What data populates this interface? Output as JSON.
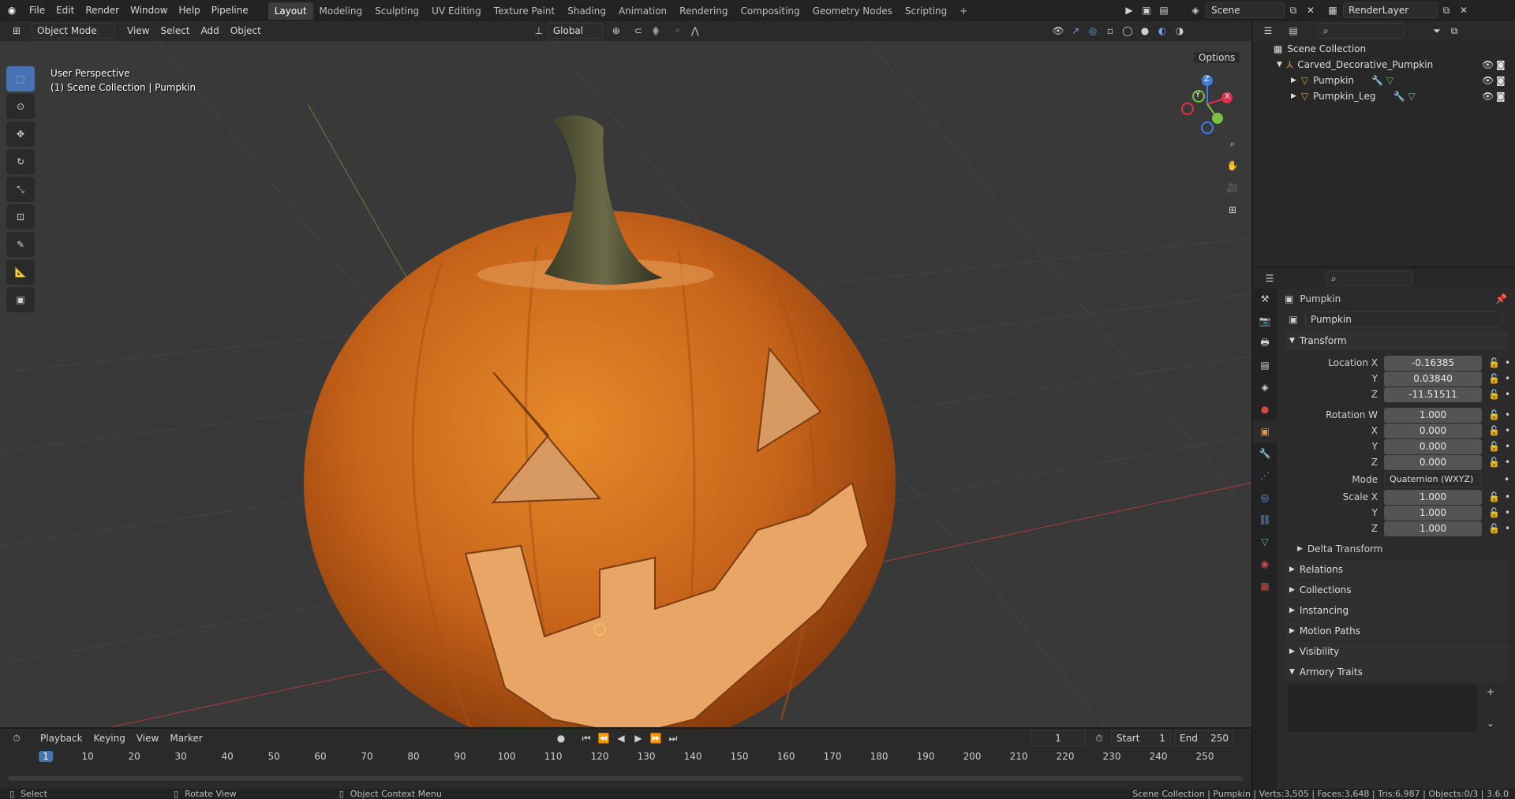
{
  "app": {
    "menu": [
      "File",
      "Edit",
      "Render",
      "Window",
      "Help",
      "Pipeline"
    ],
    "workspaces": [
      "Layout",
      "Modeling",
      "Sculpting",
      "UV Editing",
      "Texture Paint",
      "Shading",
      "Animation",
      "Rendering",
      "Compositing",
      "Geometry Nodes",
      "Scripting"
    ],
    "active_workspace": "Layout",
    "scene": "Scene",
    "view_layer": "RenderLayer"
  },
  "viewport_header": {
    "mode": "Object Mode",
    "menus": [
      "View",
      "Select",
      "Add",
      "Object"
    ],
    "orientation": "Global",
    "options": "Options"
  },
  "viewport": {
    "perspective": "User Perspective",
    "collection_info": "(1) Scene Collection | Pumpkin",
    "gizmo": {
      "x": "X",
      "y": "Y",
      "z": "Z"
    }
  },
  "outliner": {
    "root": "Scene Collection",
    "items": [
      {
        "name": "Carved_Decorative_Pumpkin"
      },
      {
        "name": "Pumpkin"
      },
      {
        "name": "Pumpkin_Leg"
      }
    ]
  },
  "properties": {
    "object_name": "Pumpkin",
    "object_field": "Pumpkin",
    "transform_title": "Transform",
    "location": {
      "label": "Location X",
      "x": "-0.16385",
      "y": "0.03840",
      "z": "-11.51511"
    },
    "rotation": {
      "label": "Rotation W",
      "w": "1.000",
      "x": "0.000",
      "y": "0.000",
      "z": "0.000"
    },
    "mode": {
      "label": "Mode",
      "value": "Quaternion (WXYZ)"
    },
    "scale": {
      "label": "Scale X",
      "x": "1.000",
      "y": "1.000",
      "z": "1.000"
    },
    "axis_labels": {
      "y": "Y",
      "z": "Z",
      "x": "X"
    },
    "delta": "Delta Transform",
    "panels": [
      "Relations",
      "Collections",
      "Instancing",
      "Motion Paths",
      "Visibility",
      "Armory Traits"
    ]
  },
  "timeline": {
    "menus": [
      "Playback",
      "Keying",
      "View",
      "Marker"
    ],
    "current_frame": "1",
    "start_label": "Start",
    "start": "1",
    "end_label": "End",
    "end": "250",
    "ticks": [
      "1",
      "10",
      "20",
      "30",
      "40",
      "50",
      "60",
      "70",
      "80",
      "90",
      "100",
      "110",
      "120",
      "130",
      "140",
      "150",
      "160",
      "170",
      "180",
      "190",
      "200",
      "210",
      "220",
      "230",
      "240",
      "250"
    ]
  },
  "status": {
    "select": "Select",
    "rotate": "Rotate View",
    "context": "Object Context Menu",
    "stats": "Scene Collection | Pumpkin | Verts:3,505 | Faces:3,648 | Tris:6,987 | Objects:0/3 | 3.6.0"
  },
  "colors": {
    "accent": "#4772b3",
    "pumpkin": "#d87a1c",
    "bg": "#393939"
  }
}
